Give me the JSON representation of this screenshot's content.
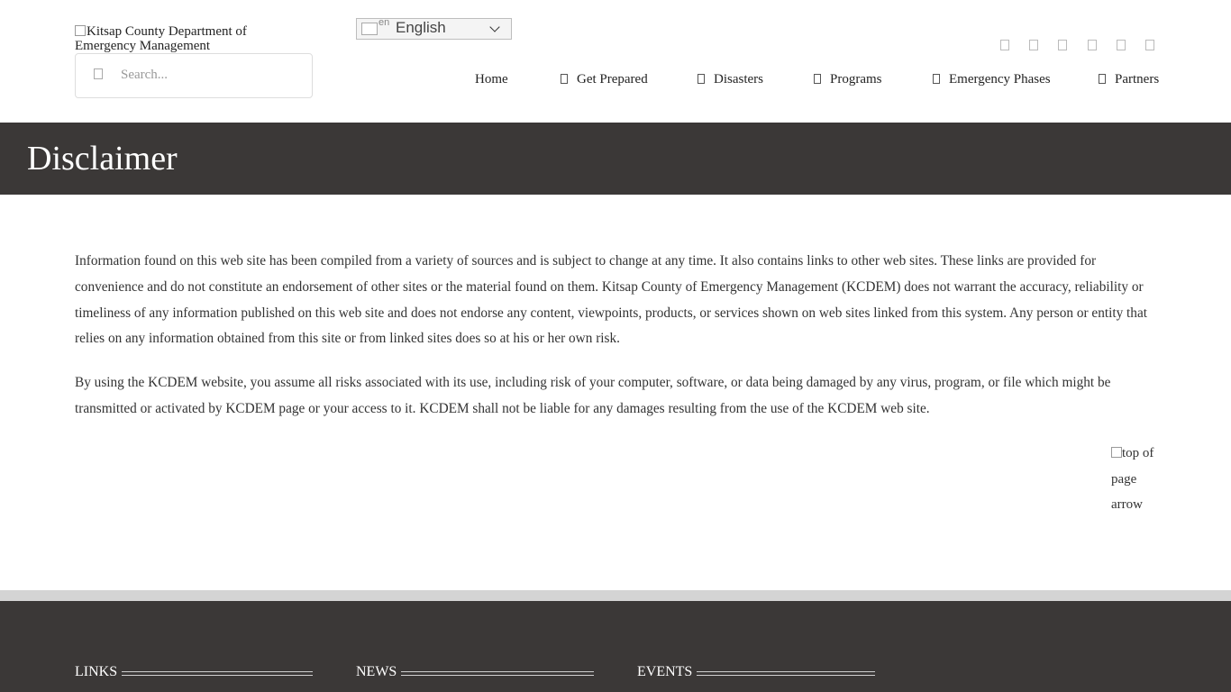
{
  "header": {
    "logo_alt": "Kitsap County Department of Emergency Management",
    "search_placeholder": "Search...",
    "language": {
      "flag_code": "en",
      "label": "English"
    },
    "social_icons": [
      "facebook-icon",
      "twitter-icon",
      "youtube-icon",
      "instagram-icon",
      "rss-icon",
      "email-icon"
    ],
    "nav": [
      {
        "label": "Home",
        "icon": ""
      },
      {
        "label": "Get Prepared",
        "icon": "checklist-icon"
      },
      {
        "label": "Disasters",
        "icon": "warning-icon"
      },
      {
        "label": "Programs",
        "icon": "folder-icon"
      },
      {
        "label": "Emergency Phases",
        "icon": "cycle-icon"
      },
      {
        "label": "Partners",
        "icon": "handshake-icon"
      }
    ]
  },
  "page": {
    "title": "Disclaimer",
    "paragraphs": [
      "Information found on this web site has been compiled from a variety of sources and is subject to change at any time. It also contains links to other web sites. These links are provided for convenience and do not constitute an endorsement of other sites or the material found on them. Kitsap County of Emergency Management (KCDEM) does not warrant the accuracy, reliability or timeliness of any information published on this web site and does not endorse any content, viewpoints, products, or services shown on web sites linked from this system. Any person or entity that relies on any information obtained from this site or from linked sites does so at his or her own risk.",
      "By using the KCDEM website, you assume all risks associated with its use, including risk of your computer, software, or data being damaged by any virus, program, or file which might be transmitted or activated by KCDEM page or your access to it. KCDEM shall not be liable for any damages resulting from the use of the KCDEM web site."
    ],
    "top_arrow_alt": "top of page arrow"
  },
  "footer": {
    "headings": [
      "LINKS",
      "NEWS",
      "EVENTS"
    ]
  },
  "colors": {
    "band": "#3b3837",
    "strip": "#d4d4d4",
    "text": "#333333"
  }
}
